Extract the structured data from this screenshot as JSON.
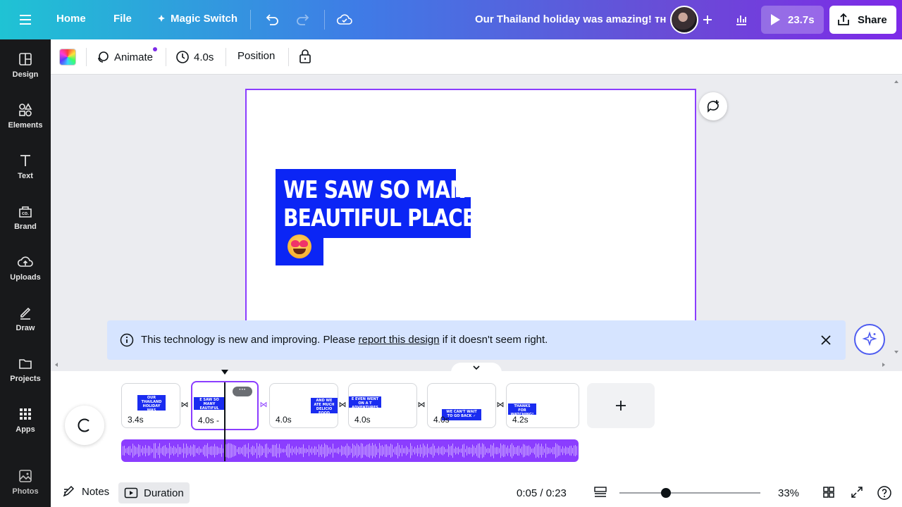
{
  "topbar": {
    "home": "Home",
    "file": "File",
    "magic_switch": "Magic Switch",
    "doc_title": "Our Thailand holiday was amazing! ᴛʜ",
    "play_duration": "23.7s",
    "share": "Share"
  },
  "sidebar": {
    "items": [
      {
        "label": "Design",
        "icon": "design-icon"
      },
      {
        "label": "Elements",
        "icon": "elements-icon"
      },
      {
        "label": "Text",
        "icon": "text-icon"
      },
      {
        "label": "Brand",
        "icon": "brand-icon"
      },
      {
        "label": "Uploads",
        "icon": "uploads-icon"
      },
      {
        "label": "Draw",
        "icon": "draw-icon"
      },
      {
        "label": "Projects",
        "icon": "projects-icon"
      },
      {
        "label": "Apps",
        "icon": "apps-icon"
      },
      {
        "label": "Photos",
        "icon": "photos-icon"
      }
    ]
  },
  "context_toolbar": {
    "animate": "Animate",
    "duration": "4.0s",
    "position": "Position"
  },
  "canvas": {
    "headline_line1": "WE SAW SO MANY",
    "headline_line2": "BEAUTIFUL PLACES",
    "accent_color": "#0b25f5",
    "selection_color": "#8b3dff"
  },
  "banner": {
    "text_before": "This technology is new and improving. Please ",
    "link": "report this design",
    "text_after": " if it doesn't seem right."
  },
  "timeline": {
    "clips": [
      {
        "duration": "3.4s",
        "thumb": "OUR THAILAND HOLIDAY WAS AMAZING! ᴛʜ"
      },
      {
        "duration": "4.0s -",
        "thumb": "E SAW SO MANY EAUTIFUL PLACES"
      },
      {
        "duration": "4.0s",
        "thumb": "AND WE ATE MUCH DELICIO FOOD"
      },
      {
        "duration": "4.0s",
        "thumb": "E EVEN WENT ON A T ADVENTURES"
      },
      {
        "duration": "4.0s",
        "thumb": "WE CAN'T WAIT TO GO BACK ✓"
      },
      {
        "duration": "4.2s",
        "thumb": "THANKS FOR WATCHING! ★"
      }
    ],
    "more": "···",
    "notes": "Notes",
    "duration": "Duration",
    "time": "0:05 / 0:23",
    "zoom": "33%",
    "zoom_level": 0.33
  }
}
